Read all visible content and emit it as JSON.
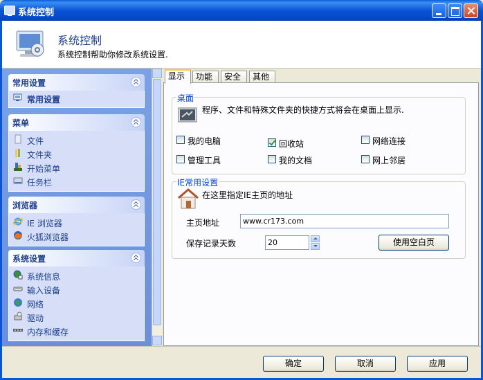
{
  "window": {
    "title": "系统控制"
  },
  "header": {
    "title": "系统控制",
    "subtitle": "系统控制帮助你修改系统设置."
  },
  "sidebar": {
    "groups": [
      {
        "title": "常用设置",
        "items": [
          {
            "label": "常用设置",
            "icon": "settings-icon"
          }
        ]
      },
      {
        "title": "菜单",
        "items": [
          {
            "label": "文件",
            "icon": "file-icon"
          },
          {
            "label": "文件夹",
            "icon": "folder-icon"
          },
          {
            "label": "开始菜单",
            "icon": "start-menu-icon"
          },
          {
            "label": "任务栏",
            "icon": "taskbar-icon"
          }
        ]
      },
      {
        "title": "浏览器",
        "items": [
          {
            "label": "IE 浏览器",
            "icon": "ie-icon"
          },
          {
            "label": "火狐浏览器",
            "icon": "firefox-icon"
          }
        ]
      },
      {
        "title": "系统设置",
        "items": [
          {
            "label": "系统信息",
            "icon": "system-info-icon"
          },
          {
            "label": "输入设备",
            "icon": "input-device-icon"
          },
          {
            "label": "网络",
            "icon": "network-icon"
          },
          {
            "label": "驱动",
            "icon": "driver-icon"
          },
          {
            "label": "内存和缓存",
            "icon": "memory-icon"
          }
        ]
      }
    ]
  },
  "tabs": [
    {
      "label": "显示"
    },
    {
      "label": "功能"
    },
    {
      "label": "安全"
    },
    {
      "label": "其他"
    }
  ],
  "desktop": {
    "legend": "桌面",
    "description": "程序、文件和特殊文件夹的快捷方式将会在桌面上显示.",
    "items": [
      {
        "label": "我的电脑",
        "checked": false
      },
      {
        "label": "回收站",
        "checked": true
      },
      {
        "label": "网络连接",
        "checked": false
      },
      {
        "label": "管理工具",
        "checked": false
      },
      {
        "label": "我的文档",
        "checked": false
      },
      {
        "label": "网上邻居",
        "checked": false
      }
    ]
  },
  "ie": {
    "legend": "IE常用设置",
    "description": "在这里指定IE主页的地址",
    "homepage_label": "主页地址",
    "homepage_value": "www.cr173.com",
    "history_label": "保存记录天数",
    "history_value": "20",
    "blank_button": "使用空白页"
  },
  "footer": {
    "ok": "确定",
    "cancel": "取消",
    "apply": "应用"
  },
  "colors": {
    "titlebar": "#0a54d6",
    "accent_text": "#1e3f8f",
    "legend": "#0046d5"
  }
}
